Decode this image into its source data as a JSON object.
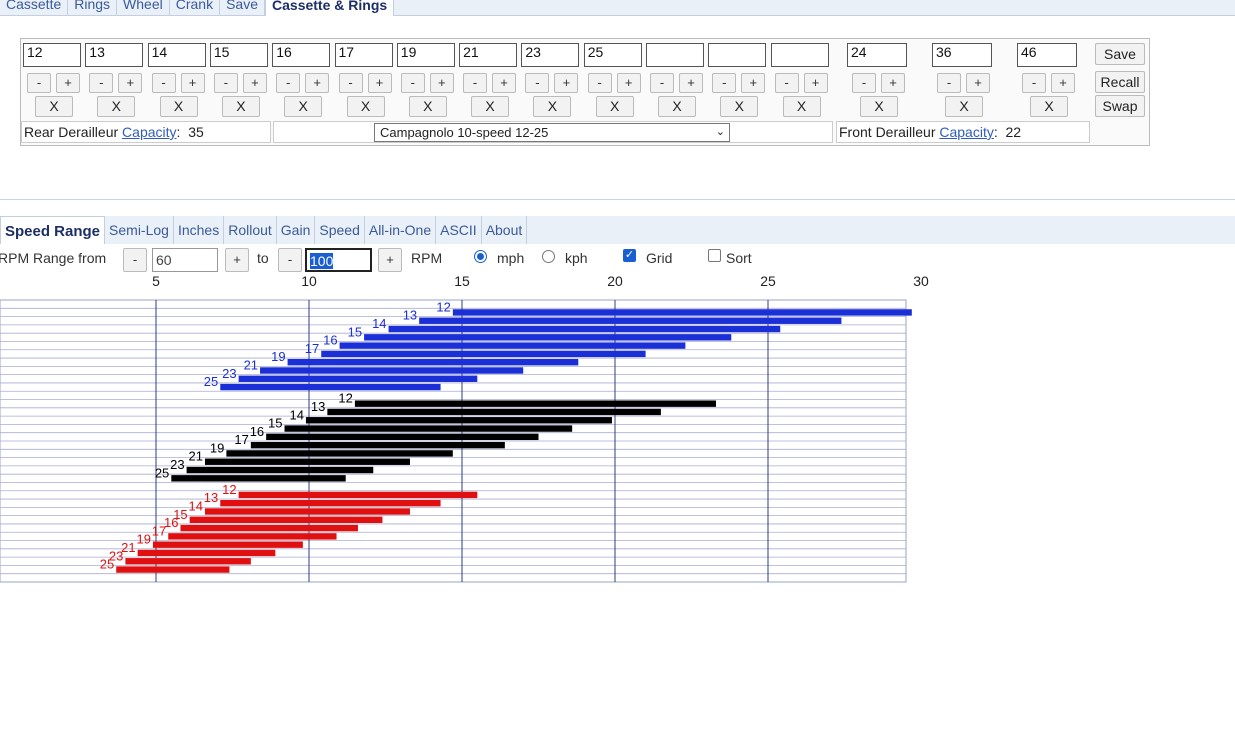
{
  "top_tabs": [
    {
      "label": "Cassette",
      "active": false
    },
    {
      "label": "Rings",
      "active": false
    },
    {
      "label": "Wheel",
      "active": false
    },
    {
      "label": "Crank",
      "active": false
    },
    {
      "label": "Save",
      "active": false
    },
    {
      "label": "Cassette & Rings",
      "active": true
    }
  ],
  "cassette": {
    "cogs": [
      "12",
      "13",
      "14",
      "15",
      "16",
      "17",
      "19",
      "21",
      "23",
      "25",
      "",
      "",
      ""
    ],
    "minus_label": "-",
    "plus_label": "+",
    "remove_label": "X",
    "rear_capacity": {
      "label_prefix": "Rear Derailleur",
      "link": "Capacity",
      "colon": ":",
      "value": "35"
    },
    "preset": "Campagnolo 10-speed 12-25",
    "preset_arrow": "⌄"
  },
  "rings": {
    "values": [
      "24",
      "36",
      "46"
    ],
    "front_capacity": {
      "label_prefix": "Front Derailleur",
      "link": "Capacity",
      "colon": ":",
      "value": "22"
    }
  },
  "actions": {
    "save": "Save",
    "recall": "Recall",
    "swap": "Swap"
  },
  "chart_tabs": [
    {
      "label": "Speed Range",
      "active": true
    },
    {
      "label": "Semi-Log",
      "active": false
    },
    {
      "label": "Inches",
      "active": false
    },
    {
      "label": "Rollout",
      "active": false
    },
    {
      "label": "Gain",
      "active": false
    },
    {
      "label": "Speed",
      "active": false
    },
    {
      "label": "All-in-One",
      "active": false
    },
    {
      "label": "ASCII",
      "active": false
    },
    {
      "label": "About",
      "active": false
    }
  ],
  "rpm": {
    "label": "RPM Range from",
    "from": "60",
    "to_label": "to",
    "to": "100",
    "unit": "RPM",
    "minus_label": "-",
    "plus_label": "+"
  },
  "options": {
    "mph": {
      "label": "mph",
      "selected": true
    },
    "kph": {
      "label": "kph",
      "selected": false
    },
    "grid": {
      "label": "Grid",
      "checked": true
    },
    "sort": {
      "label": "Sort",
      "checked": false
    }
  },
  "chart_data": {
    "type": "bar",
    "x_ticks": [
      5,
      10,
      15,
      20,
      25,
      30
    ],
    "xlim": [
      0.2,
      30
    ],
    "grid": true,
    "series": [
      {
        "ring": 46,
        "color": "#1b2fd6",
        "cogs": [
          "12",
          "13",
          "14",
          "15",
          "16",
          "17",
          "19",
          "21",
          "23",
          "25"
        ],
        "ranges": [
          [
            14.7,
            29.7
          ],
          [
            13.6,
            27.4
          ],
          [
            12.6,
            25.4
          ],
          [
            11.8,
            23.8
          ],
          [
            11.0,
            22.3
          ],
          [
            10.4,
            21.0
          ],
          [
            9.3,
            18.8
          ],
          [
            8.4,
            17.0
          ],
          [
            7.7,
            15.5
          ],
          [
            7.1,
            14.3
          ]
        ]
      },
      {
        "ring": 36,
        "color": "#000000",
        "cogs": [
          "12",
          "13",
          "14",
          "15",
          "16",
          "17",
          "19",
          "21",
          "23",
          "25"
        ],
        "ranges": [
          [
            11.5,
            23.3
          ],
          [
            10.6,
            21.5
          ],
          [
            9.9,
            19.9
          ],
          [
            9.2,
            18.6
          ],
          [
            8.6,
            17.5
          ],
          [
            8.1,
            16.4
          ],
          [
            7.3,
            14.7
          ],
          [
            6.6,
            13.3
          ],
          [
            6.0,
            12.1
          ],
          [
            5.5,
            11.2
          ]
        ]
      },
      {
        "ring": 24,
        "color": "#e01010",
        "cogs": [
          "12",
          "13",
          "14",
          "15",
          "16",
          "17",
          "19",
          "21",
          "23",
          "25"
        ],
        "ranges": [
          [
            7.7,
            15.5
          ],
          [
            7.1,
            14.3
          ],
          [
            6.6,
            13.3
          ],
          [
            6.1,
            12.4
          ],
          [
            5.8,
            11.6
          ],
          [
            5.4,
            10.9
          ],
          [
            4.9,
            9.8
          ],
          [
            4.4,
            8.9
          ],
          [
            4.0,
            8.1
          ],
          [
            3.7,
            7.4
          ]
        ]
      }
    ]
  }
}
